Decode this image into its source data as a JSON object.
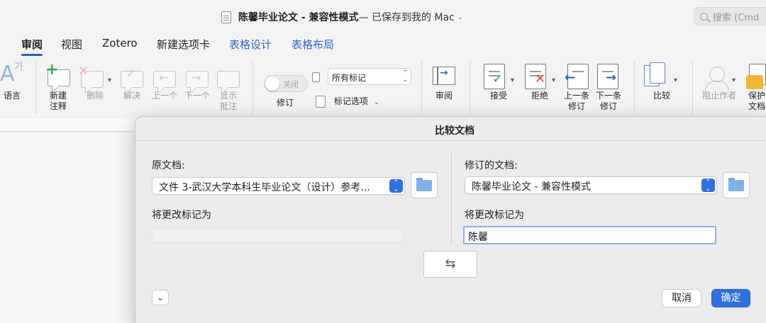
{
  "window": {
    "title_bold": "陈馨毕业论文 - 兼容性模式",
    "title_suffix": " — 已保存到我的 Mac",
    "title_chevron": "⌄",
    "search_placeholder": "搜索 (Cmd"
  },
  "tabs": [
    {
      "label": "审阅",
      "active": true
    },
    {
      "label": "视图"
    },
    {
      "label": "Zotero"
    },
    {
      "label": "新建选项卡"
    },
    {
      "label": "表格设计",
      "color": "#2f63c4"
    },
    {
      "label": "表格布局",
      "color": "#2f63c4"
    }
  ],
  "ribbon": {
    "language": "语言",
    "new_comment": [
      "新建",
      "注释"
    ],
    "delete": "删除",
    "resolve": "解决",
    "previous": "上一个",
    "next": "下一个",
    "show_comments": [
      "显示",
      "批注"
    ],
    "track_toggle_state": "关闭",
    "track_changes": "修订",
    "markup_select": "所有标记",
    "markup_options": "标记选项",
    "reviewing": "审阅",
    "accept": "接受",
    "reject": "拒绝",
    "prev_change": [
      "上一条",
      "修订"
    ],
    "next_change": [
      "下一条",
      "修订"
    ],
    "compare": "比较",
    "block_authors": "阻止作者",
    "protect": [
      "保护",
      "文档"
    ]
  },
  "dialog": {
    "title": "比较文档",
    "original_label": "原文档:",
    "original_value": "文件 3-武汉大学本科生毕业论文（设计）参考...",
    "original_mark_label": "将更改标记为",
    "original_mark_value": "",
    "revised_label": "修订的文档:",
    "revised_value": "陈馨毕业论文 - 兼容性模式",
    "revised_mark_label": "将更改标记为",
    "revised_mark_value": "陈馨",
    "cancel": "取消",
    "ok": "确定"
  },
  "colors": {
    "accent": "#2f6fe0",
    "tab_blue": "#2f63c4",
    "new_comment_plus": "#33a853",
    "reject_x": "#d94343"
  },
  "icons": [
    "search-icon",
    "document-icon",
    "new-comment-icon",
    "delete-comment-icon",
    "resolve-icon",
    "previous-comment-icon",
    "next-comment-icon",
    "show-comments-icon",
    "reviewing-pane-icon",
    "accept-icon",
    "reject-icon",
    "previous-change-icon",
    "next-change-icon",
    "compare-icon",
    "block-authors-icon",
    "protect-document-icon",
    "folder-icon",
    "swap-icon",
    "chevron-down-icon"
  ]
}
